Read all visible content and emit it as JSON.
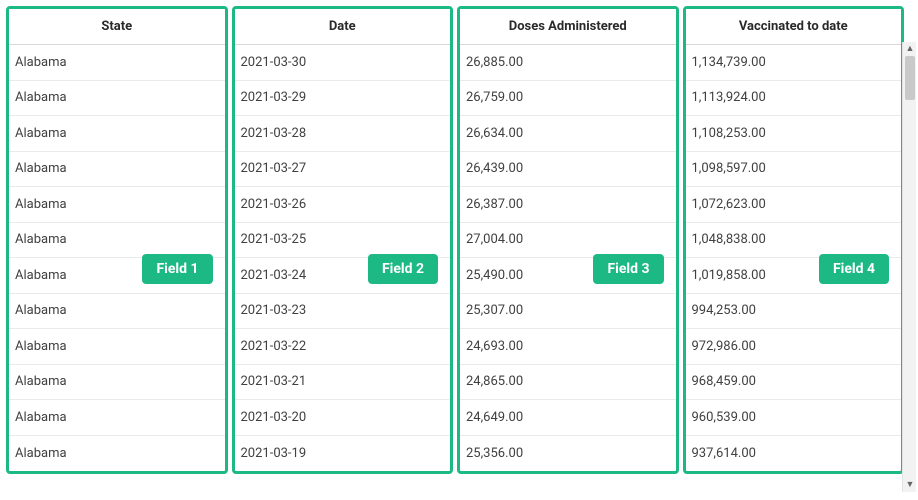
{
  "table": {
    "columns": [
      {
        "header": "State",
        "badge": "Field 1"
      },
      {
        "header": "Date",
        "badge": "Field 2"
      },
      {
        "header": "Doses Administered",
        "badge": "Field 3"
      },
      {
        "header": "Vaccinated to date",
        "badge": "Field 4"
      }
    ],
    "rows": [
      {
        "state": "Alabama",
        "date": "2021-03-30",
        "doses": "26,885.00",
        "vaccinated": "1,134,739.00"
      },
      {
        "state": "Alabama",
        "date": "2021-03-29",
        "doses": "26,759.00",
        "vaccinated": "1,113,924.00"
      },
      {
        "state": "Alabama",
        "date": "2021-03-28",
        "doses": "26,634.00",
        "vaccinated": "1,108,253.00"
      },
      {
        "state": "Alabama",
        "date": "2021-03-27",
        "doses": "26,439.00",
        "vaccinated": "1,098,597.00"
      },
      {
        "state": "Alabama",
        "date": "2021-03-26",
        "doses": "26,387.00",
        "vaccinated": "1,072,623.00"
      },
      {
        "state": "Alabama",
        "date": "2021-03-25",
        "doses": "27,004.00",
        "vaccinated": "1,048,838.00"
      },
      {
        "state": "Alabama",
        "date": "2021-03-24",
        "doses": "25,490.00",
        "vaccinated": "1,019,858.00"
      },
      {
        "state": "Alabama",
        "date": "2021-03-23",
        "doses": "25,307.00",
        "vaccinated": "994,253.00"
      },
      {
        "state": "Alabama",
        "date": "2021-03-22",
        "doses": "24,693.00",
        "vaccinated": "972,986.00"
      },
      {
        "state": "Alabama",
        "date": "2021-03-21",
        "doses": "24,865.00",
        "vaccinated": "968,459.00"
      },
      {
        "state": "Alabama",
        "date": "2021-03-20",
        "doses": "24,649.00",
        "vaccinated": "960,539.00"
      },
      {
        "state": "Alabama",
        "date": "2021-03-19",
        "doses": "25,356.00",
        "vaccinated": "937,614.00"
      }
    ]
  }
}
